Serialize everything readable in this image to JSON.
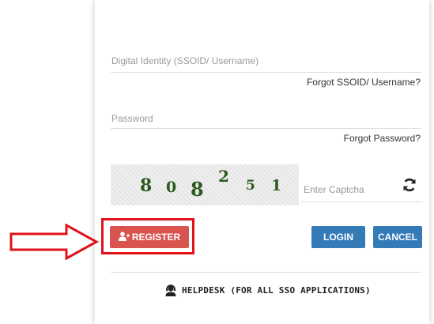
{
  "login_form": {
    "username_placeholder": "Digital Identity (SSOID/ Username)",
    "forgot_username": "Forgot SSOID/ Username?",
    "password_placeholder": "Password",
    "forgot_password": "Forgot Password?",
    "captcha_digits": [
      "8",
      "0",
      "8",
      "2",
      "5",
      "1"
    ],
    "captcha_placeholder": "Enter Captcha",
    "refresh_icon": "refresh-icon"
  },
  "buttons": {
    "register_label": "REGISTER",
    "register_icon": "add-user-icon",
    "login_label": "LOGIN",
    "cancel_label": "CANCEL"
  },
  "helpdesk": {
    "label": "HELPDESK (FOR ALL SSO APPLICATIONS)",
    "icon": "support-agent-icon"
  },
  "annotation": {
    "arrow_icon": "right-arrow-icon",
    "highlight_color": "#e0121a"
  },
  "colors": {
    "register": "#d9534f",
    "primary": "#337ab7",
    "captcha_text": "#2d5a1e"
  }
}
